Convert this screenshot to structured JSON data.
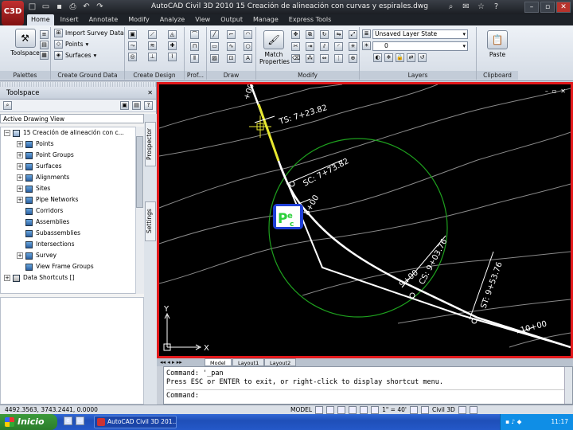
{
  "window": {
    "title": "AutoCAD Civil 3D 2010    15 Creación de alineación con curvas y espirales.dwg",
    "app_button": "C3D"
  },
  "tabs": [
    "Home",
    "Insert",
    "Annotate",
    "Modify",
    "Analyze",
    "View",
    "Output",
    "Manage",
    "Express Tools"
  ],
  "ribbon": {
    "palettes": {
      "toolspace_label": "Toolspace",
      "title": "Palettes"
    },
    "create_ground": {
      "title": "Create Ground Data",
      "items": [
        "Import Survey Data",
        "Points",
        "Surfaces"
      ]
    },
    "create_design": {
      "title": "Create Design"
    },
    "profile": {
      "title": "Prof..."
    },
    "draw": {
      "title": "Draw"
    },
    "modify": {
      "title": "Modify",
      "match_label": "Match Properties"
    },
    "layers": {
      "title": "Layers",
      "layer_state": "Unsaved Layer State",
      "current_layer": "0"
    },
    "clipboard": {
      "title": "Clipboard",
      "paste_label": "Paste"
    }
  },
  "toolspace": {
    "title": "Toolspace",
    "view": "Active Drawing View",
    "drawing": "15 Creación de alineación con c...",
    "items": [
      "Points",
      "Point Groups",
      "Surfaces",
      "Alignments",
      "Sites",
      "Pipe Networks",
      "Corridors",
      "Assemblies",
      "Subassemblies",
      "Intersections",
      "Survey",
      "View Frame Groups"
    ],
    "data_shortcuts": "Data Shortcuts []",
    "side_tabs": [
      "Prospector",
      "Settings"
    ]
  },
  "drawing": {
    "labels": [
      "TS: 7+23.82",
      "SC: 7+73.82",
      "8+00",
      "CS: 9+03.76",
      "ST: 9+53.76",
      "9+00",
      "10+00",
      "+00"
    ],
    "ucs_x": "X",
    "ucs_y": "Y"
  },
  "layout_tabs": [
    "Model",
    "Layout1",
    "Layout2"
  ],
  "command": {
    "line1": "Command: '_pan",
    "line2": "Press ESC or ENTER to exit, or right-click to display shortcut menu.",
    "line3": "Command:"
  },
  "status": {
    "coords": "4492.3563, 3743.2441, 0.0000",
    "model": "MODEL",
    "scale": "1\" = 40'",
    "workspace": "Civil 3D"
  },
  "taskbar": {
    "start": "Inicio",
    "task": "AutoCAD Civil 3D 201...",
    "lang": "ES",
    "time": "11:17"
  },
  "colors": {
    "viewport_border": "#e3191c",
    "alignment": "#ffffff",
    "highlight": "#e8e830",
    "circle": "#1ea01e",
    "contour": "#8a8a8a",
    "logo_bg": "#1f3fd8",
    "logo_text": "#2ad03a"
  }
}
